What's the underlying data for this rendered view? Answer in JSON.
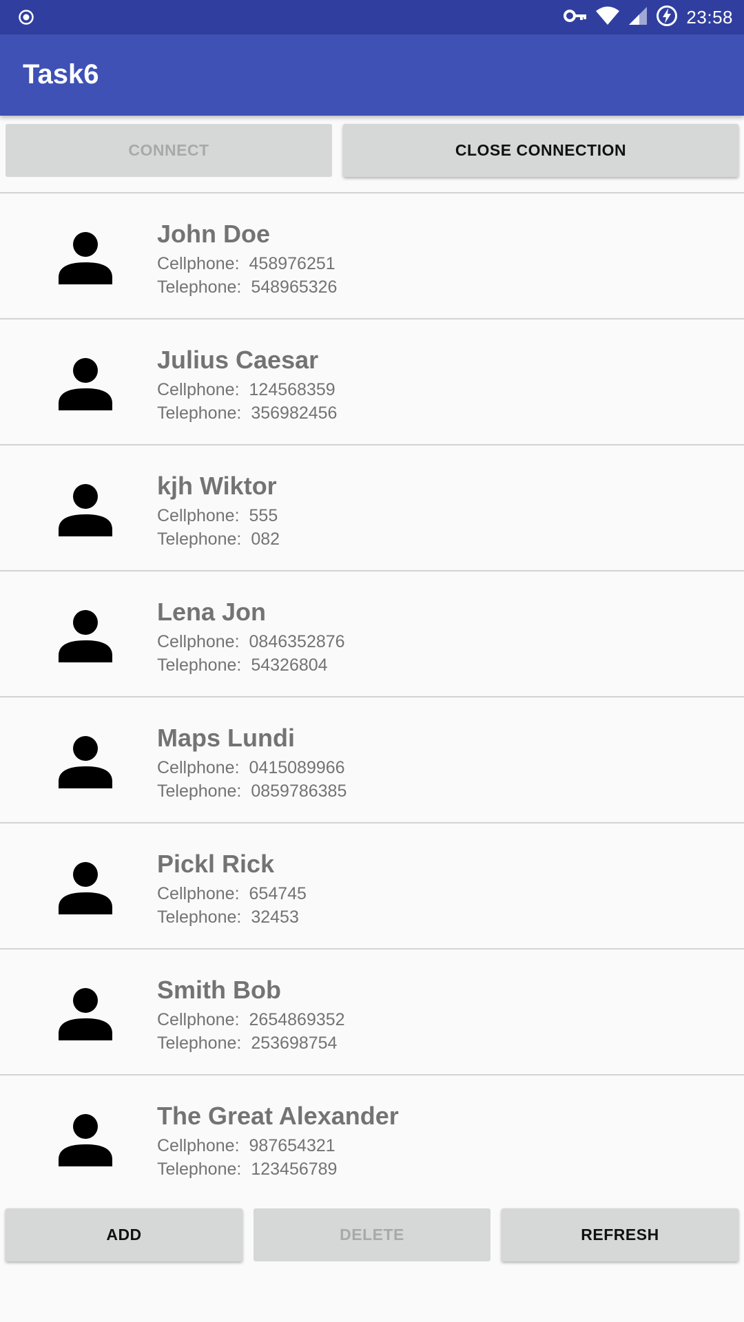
{
  "status_bar": {
    "time": "23:58"
  },
  "app_bar": {
    "title": "Task6"
  },
  "top_buttons": {
    "connect": "CONNECT",
    "close_connection": "CLOSE CONNECTION"
  },
  "contacts": [
    {
      "name": "John Doe",
      "cell_label": "Cellphone:",
      "cell": "458976251",
      "tel_label": "Telephone:",
      "tel": "548965326"
    },
    {
      "name": "Julius Caesar",
      "cell_label": "Cellphone:",
      "cell": "124568359",
      "tel_label": "Telephone:",
      "tel": "356982456"
    },
    {
      "name": "kjh Wiktor",
      "cell_label": "Cellphone:",
      "cell": "555",
      "tel_label": "Telephone:",
      "tel": "082"
    },
    {
      "name": "Lena Jon",
      "cell_label": "Cellphone:",
      "cell": "0846352876",
      "tel_label": "Telephone:",
      "tel": "54326804"
    },
    {
      "name": "Maps Lundi",
      "cell_label": "Cellphone:",
      "cell": "0415089966",
      "tel_label": "Telephone:",
      "tel": "0859786385"
    },
    {
      "name": "Pickl Rick",
      "cell_label": "Cellphone:",
      "cell": "654745",
      "tel_label": "Telephone:",
      "tel": "32453"
    },
    {
      "name": "Smith Bob",
      "cell_label": "Cellphone:",
      "cell": "2654869352",
      "tel_label": "Telephone:",
      "tel": "253698754"
    },
    {
      "name": "The Great Alexander",
      "cell_label": "Cellphone:",
      "cell": "987654321",
      "tel_label": "Telephone:",
      "tel": "123456789"
    }
  ],
  "bottom_buttons": {
    "add": "ADD",
    "delete": "DELETE",
    "refresh": "REFRESH"
  },
  "colors": {
    "primary": "#3f51b5",
    "primary_dark": "#303f9f",
    "button": "#d6d7d7",
    "disabled_text": "#a9a9a9"
  },
  "icons": [
    "target-icon",
    "key-icon",
    "wifi-icon",
    "signal-icon",
    "battery-charging-icon",
    "person-icon"
  ]
}
